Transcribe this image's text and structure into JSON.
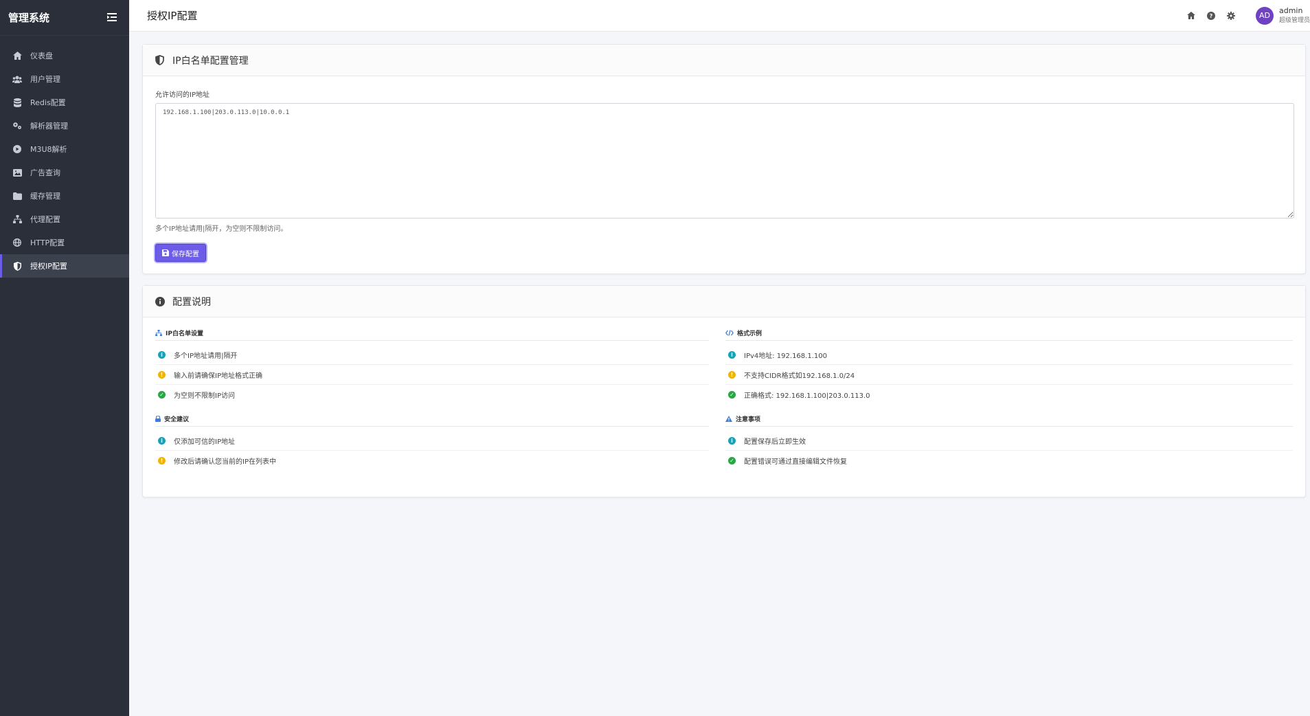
{
  "sidebar": {
    "title": "管理系统",
    "items": [
      {
        "label": "仪表盘",
        "icon": "home-icon"
      },
      {
        "label": "用户管理",
        "icon": "users-icon"
      },
      {
        "label": "Redis配置",
        "icon": "database-icon"
      },
      {
        "label": "解析器管理",
        "icon": "cogs-icon"
      },
      {
        "label": "M3U8解析",
        "icon": "play-icon"
      },
      {
        "label": "广告查询",
        "icon": "image-icon"
      },
      {
        "label": "缓存管理",
        "icon": "folder-icon"
      },
      {
        "label": "代理配置",
        "icon": "sitemap-icon"
      },
      {
        "label": "HTTP配置",
        "icon": "globe-icon"
      },
      {
        "label": "授权IP配置",
        "icon": "shield-icon",
        "active": true
      }
    ]
  },
  "topbar": {
    "title": "授权IP配置",
    "user": {
      "initials": "AD",
      "name": "admin",
      "role": "超级管理员"
    }
  },
  "whitelist": {
    "card_title": "IP白名单配置管理",
    "label": "允许访问的IP地址",
    "value": "192.168.1.100|203.0.113.0|10.0.0.1",
    "help": "多个IP地址请用|隔开，为空则不限制访问。",
    "save_label": "保存配置"
  },
  "guide": {
    "card_title": "配置说明",
    "sections": {
      "whitelist_settings": {
        "title": "IP白名单设置",
        "items": [
          "多个IP地址请用|隔开",
          "输入前请确保IP地址格式正确",
          "为空则不限制IP访问"
        ]
      },
      "format_examples": {
        "title": "格式示例",
        "items": [
          "IPv4地址: 192.168.1.100",
          "不支持CIDR格式如192.168.1.0/24",
          "正确格式: 192.168.1.100|203.0.113.0"
        ]
      },
      "security": {
        "title": "安全建议",
        "items": [
          "仅添加可信的IP地址",
          "修改后请确认您当前的IP在列表中"
        ]
      },
      "notes": {
        "title": "注意事项",
        "items": [
          "配置保存后立即生效",
          "配置错误可通过直接编辑文件恢复"
        ]
      }
    }
  },
  "colors": {
    "sidebar_bg": "#2a2f3a",
    "accent": "#6c5ce7",
    "info": "#17a2b8",
    "warning": "#f0b400",
    "success": "#28a745"
  }
}
